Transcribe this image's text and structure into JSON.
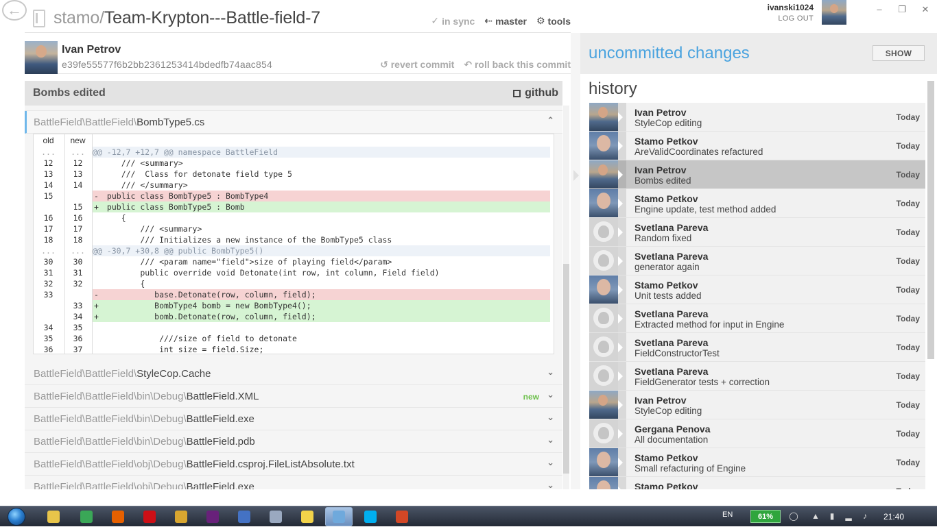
{
  "header": {
    "repo_owner": "stamo/",
    "repo_name": "Team-Krypton---Battle-field-7",
    "sync_label": "in sync",
    "branch_label": "master",
    "tools_label": "tools"
  },
  "user": {
    "name": "ivanski1024",
    "logout_label": "LOG OUT"
  },
  "commit": {
    "author": "Ivan Petrov",
    "sha": "e39fe55577f6b2bb2361253414bdedfb74aac854",
    "revert_label": "revert commit",
    "rollback_label": "roll back this commit",
    "message": "Bombs edited",
    "github_label": "github"
  },
  "files": [
    {
      "dir": "BattleField\\BattleField\\",
      "name": "BombType5.cs",
      "tag": "",
      "expanded": true
    },
    {
      "dir": "BattleField\\BattleField\\",
      "name": "StyleCop.Cache",
      "tag": ""
    },
    {
      "dir": "BattleField\\BattleField\\bin\\Debug\\",
      "name": "BattleField.XML",
      "tag": "new"
    },
    {
      "dir": "BattleField\\BattleField\\bin\\Debug\\",
      "name": "BattleField.exe",
      "tag": ""
    },
    {
      "dir": "BattleField\\BattleField\\bin\\Debug\\",
      "name": "BattleField.pdb",
      "tag": ""
    },
    {
      "dir": "BattleField\\BattleField\\obj\\Debug\\",
      "name": "BattleField.csproj.FileListAbsolute.txt",
      "tag": ""
    },
    {
      "dir": "BattleField\\BattleField\\obj\\Debug\\",
      "name": "BattleField.exe",
      "tag": ""
    }
  ],
  "diff": {
    "old_header": "old",
    "new_header": "new",
    "lines": [
      {
        "type": "hunk",
        "o": "...",
        "n": "...",
        "sign": "",
        "code": "@@ -12,7 +12,7 @@ namespace BattleField"
      },
      {
        "type": "ctx",
        "o": "12",
        "n": "12",
        "sign": "",
        "code": "    /// <summary>"
      },
      {
        "type": "ctx",
        "o": "13",
        "n": "13",
        "sign": "",
        "code": "    ///  Class for detonate field type 5"
      },
      {
        "type": "ctx",
        "o": "14",
        "n": "14",
        "sign": "",
        "code": "    /// </summary>"
      },
      {
        "type": "del",
        "o": "15",
        "n": "",
        "sign": "-",
        "code": " public class BombType5 : BombType4"
      },
      {
        "type": "add",
        "o": "",
        "n": "15",
        "sign": "+",
        "code": " public class BombType5 : Bomb"
      },
      {
        "type": "ctx",
        "o": "16",
        "n": "16",
        "sign": "",
        "code": "    {"
      },
      {
        "type": "ctx",
        "o": "17",
        "n": "17",
        "sign": "",
        "code": "        /// <summary>"
      },
      {
        "type": "ctx",
        "o": "18",
        "n": "18",
        "sign": "",
        "code": "        /// Initializes a new instance of the BombType5 class"
      },
      {
        "type": "hunk",
        "o": "...",
        "n": "...",
        "sign": "",
        "code": "@@ -30,7 +30,8 @@ public BombType5()"
      },
      {
        "type": "ctx",
        "o": "30",
        "n": "30",
        "sign": "",
        "code": "        /// <param name=\"field\">size of playing field</param>"
      },
      {
        "type": "ctx",
        "o": "31",
        "n": "31",
        "sign": "",
        "code": "        public override void Detonate(int row, int column, Field field)"
      },
      {
        "type": "ctx",
        "o": "32",
        "n": "32",
        "sign": "",
        "code": "        {"
      },
      {
        "type": "del",
        "o": "33",
        "n": "",
        "sign": "-",
        "code": "           base.Detonate(row, column, field);"
      },
      {
        "type": "add",
        "o": "",
        "n": "33",
        "sign": "+",
        "code": "           BombType4 bomb = new BombType4();"
      },
      {
        "type": "add",
        "o": "",
        "n": "34",
        "sign": "+",
        "code": "           bomb.Detonate(row, column, field);"
      },
      {
        "type": "ctx",
        "o": "34",
        "n": "35",
        "sign": "",
        "code": ""
      },
      {
        "type": "ctx",
        "o": "35",
        "n": "36",
        "sign": "",
        "code": "            ////size of field to detonate"
      },
      {
        "type": "ctx",
        "o": "36",
        "n": "37",
        "sign": "",
        "code": "            int size = field.Size;"
      }
    ]
  },
  "uncommitted": {
    "title": "uncommitted changes",
    "show_label": "SHOW"
  },
  "history": {
    "title": "history",
    "items": [
      {
        "author": "Ivan Petrov",
        "message": "StyleCop editing",
        "date": "Today",
        "avatar": "ivan"
      },
      {
        "author": "Stamo Petkov",
        "message": "AreValidCoordinates refactured",
        "date": "Today",
        "avatar": "stamo"
      },
      {
        "author": "Ivan Petrov",
        "message": "Bombs edited",
        "date": "Today",
        "avatar": "ivan",
        "selected": true
      },
      {
        "author": "Stamo Petkov",
        "message": "Engine update, test method added",
        "date": "Today",
        "avatar": "stamo"
      },
      {
        "author": "Svetlana Pareva",
        "message": "Random fixed",
        "date": "Today",
        "avatar": "gh"
      },
      {
        "author": "Svetlana Pareva",
        "message": "generator again",
        "date": "Today",
        "avatar": "gh"
      },
      {
        "author": "Stamo Petkov",
        "message": "Unit tests added",
        "date": "Today",
        "avatar": "stamo"
      },
      {
        "author": "Svetlana Pareva",
        "message": "Extracted method for input in Engine",
        "date": "Today",
        "avatar": "gh"
      },
      {
        "author": "Svetlana Pareva",
        "message": "FieldConstructorTest",
        "date": "Today",
        "avatar": "gh"
      },
      {
        "author": "Svetlana Pareva",
        "message": "FieldGenerator tests + correction",
        "date": "Today",
        "avatar": "gh"
      },
      {
        "author": "Ivan Petrov",
        "message": "StyleCop editing",
        "date": "Today",
        "avatar": "ivan"
      },
      {
        "author": "Gergana Penova",
        "message": "All documentation",
        "date": "Today",
        "avatar": "gh"
      },
      {
        "author": "Stamo Petkov",
        "message": "Small refacturing of Engine",
        "date": "Today",
        "avatar": "stamo"
      },
      {
        "author": "Stamo Petkov",
        "message": "",
        "date": "Today",
        "avatar": "stamo"
      }
    ]
  },
  "taskbar": {
    "language": "EN",
    "battery": "61%",
    "time": "21:40",
    "apps": [
      {
        "name": "explorer-icon",
        "color": "#e8c54a"
      },
      {
        "name": "chrome-icon",
        "color": "#3aa757"
      },
      {
        "name": "firefox-icon",
        "color": "#e66000"
      },
      {
        "name": "opera-icon",
        "color": "#cc0f16"
      },
      {
        "name": "winamp-icon",
        "color": "#d8a630"
      },
      {
        "name": "visual-studio-icon",
        "color": "#68217a"
      },
      {
        "name": "word-document-icon",
        "color": "#4472c4"
      },
      {
        "name": "notepad-icon",
        "color": "#9aa9c0"
      },
      {
        "name": "paint-icon",
        "color": "#f2d34a"
      },
      {
        "name": "github-for-windows-icon",
        "color": "#6fa9dc"
      },
      {
        "name": "skype-icon",
        "color": "#00aff0"
      },
      {
        "name": "powerpoint-icon",
        "color": "#d24726"
      }
    ]
  }
}
